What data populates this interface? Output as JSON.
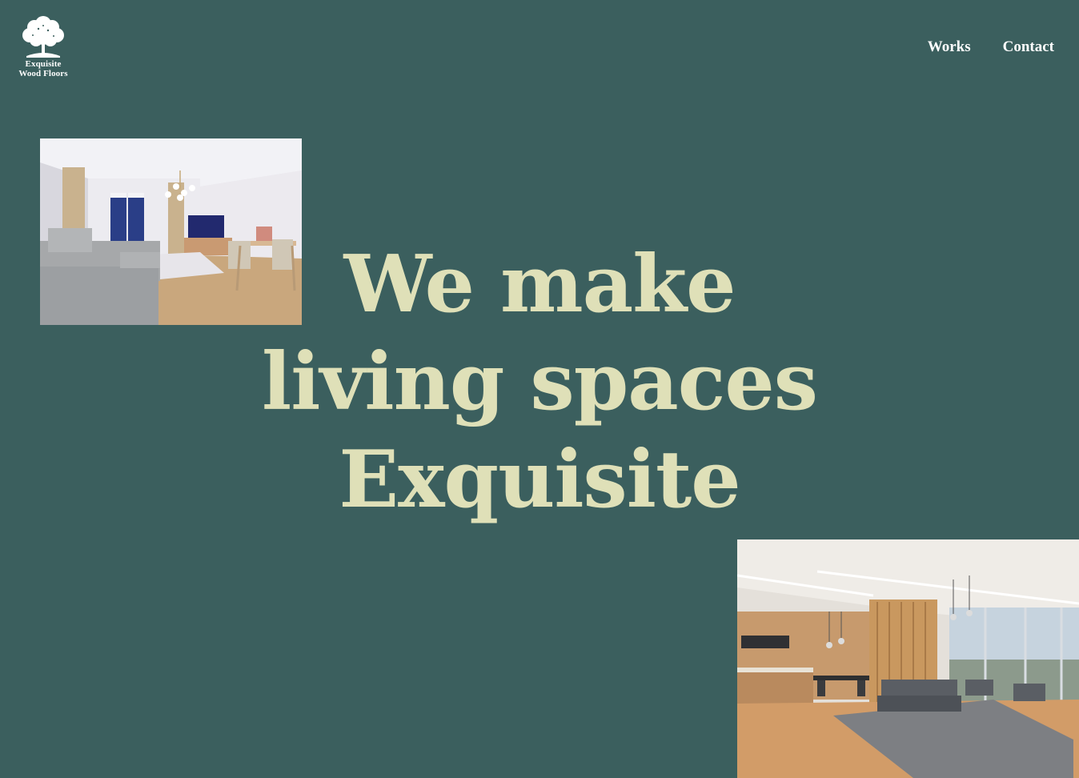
{
  "brand": {
    "line1": "Exquisite",
    "line2": "Wood Floors",
    "icon": "tree-icon"
  },
  "nav": {
    "works": "Works",
    "contact": "Contact"
  },
  "hero": {
    "line1": "We make",
    "line2": "living spaces",
    "line3": "Exquisite"
  },
  "colors": {
    "background": "#3b5f5e",
    "headline": "#dfe0b8",
    "nav_text": "#ffffff"
  }
}
